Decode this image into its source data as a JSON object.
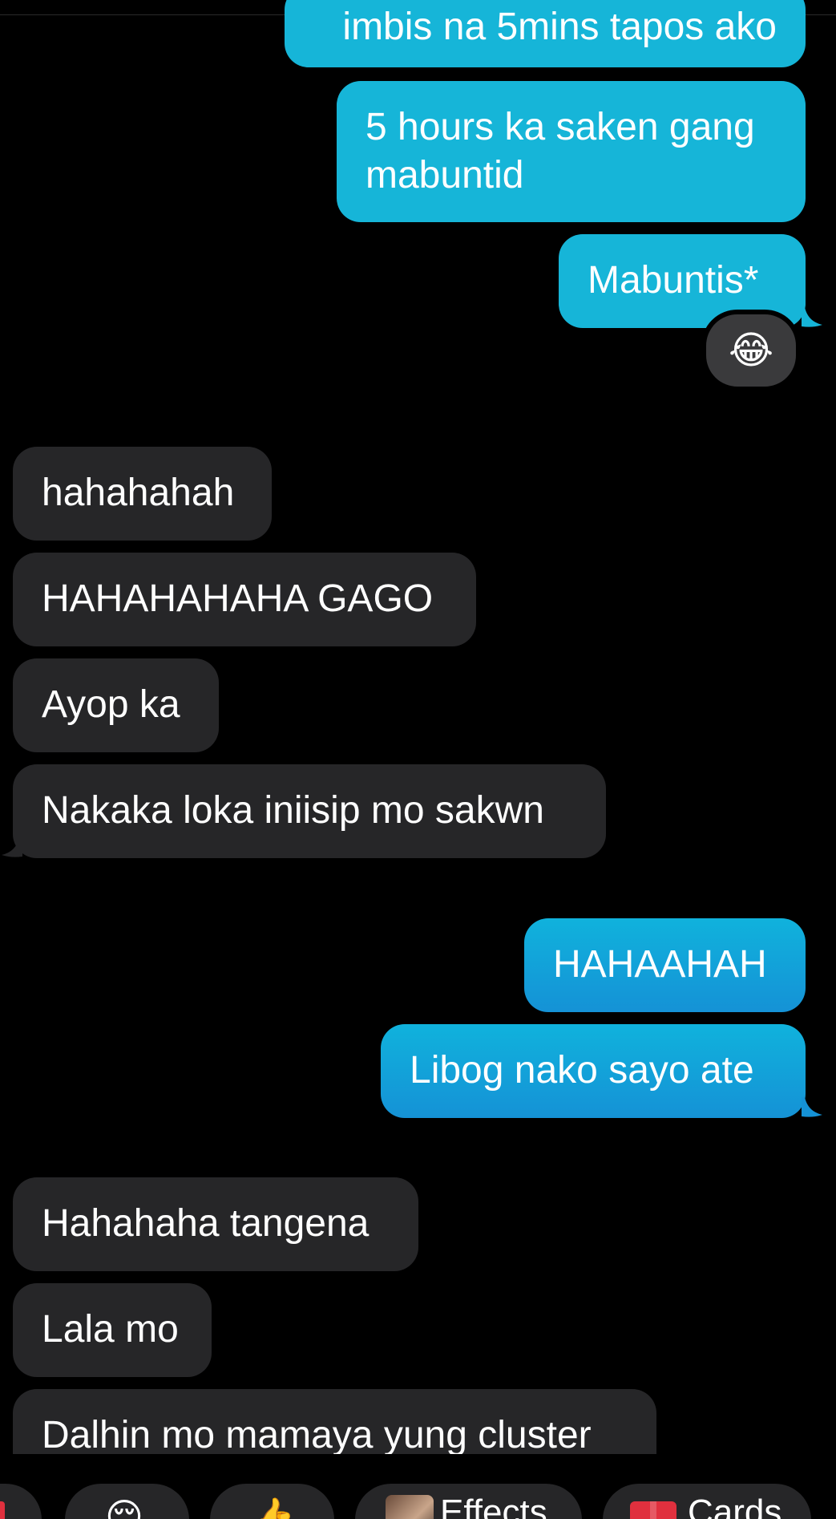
{
  "messages": {
    "m0": "imbis na 5mins tapos ako",
    "m1_line1": "5 hours ka saken gang",
    "m1_line2": "mabuntid",
    "m2": "Mabuntis*",
    "m3": "hahahahah",
    "m4": "HAHAHAHAHA GAGO",
    "m5": "Ayop ka",
    "m6": "Nakaka loka iniisip mo sakwn",
    "m7": "HAHAAHAH",
    "m8": "Libog nako sayo ate",
    "m9": "Hahahaha tangena",
    "m10": "Lala mo",
    "m11": "Dalhin mo mamaya yung cluster"
  },
  "reaction": "😂",
  "toolbar": {
    "emoji_relieved": "😌",
    "emoji_thumb": "👍",
    "effects_label": "Effects",
    "cards_label": "Cards"
  },
  "icons": {
    "reaction": "tears-of-joy-icon",
    "relieved": "relieved-face-icon",
    "thumb": "thumbs-up-icon",
    "gift": "gift-icon",
    "effects": "effects-thumbnail-icon"
  },
  "colors": {
    "outgoing_bubble": "#16b5d8",
    "incoming_bubble": "#262628",
    "background": "#000000"
  }
}
